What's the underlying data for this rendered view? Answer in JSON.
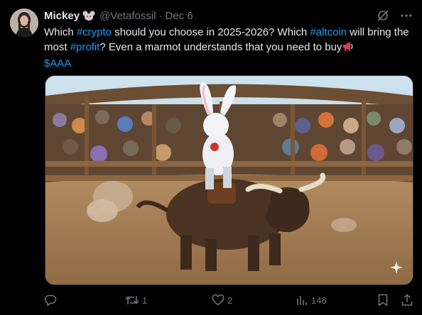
{
  "author": {
    "name": "Mickey",
    "emoji_icon": "mouse-face-icon",
    "handle": "@Vetafossil",
    "separator": "·",
    "date": "Dec 6"
  },
  "tweet": {
    "segments": [
      {
        "text": "Which ",
        "type": "plain"
      },
      {
        "text": "#crypto",
        "type": "hashtag"
      },
      {
        "text": " should you choose in 2025-2026?  Which ",
        "type": "plain"
      },
      {
        "text": "#altcoin",
        "type": "hashtag"
      },
      {
        "text": " will bring the most ",
        "type": "plain"
      },
      {
        "text": "#profit",
        "type": "hashtag"
      },
      {
        "text": "?  Even a marmot understands that you need to buy",
        "type": "plain"
      },
      {
        "text": "$AAA",
        "type": "cashtag"
      }
    ],
    "emoji_after_buy": "loudspeaker-icon"
  },
  "media": {
    "description_icon": "sparkle-icon"
  },
  "actions": {
    "reply_count": "",
    "retweet_count": "1",
    "like_count": "2",
    "views_count": "146"
  },
  "colors": {
    "background": "#000000",
    "text": "#e7e9ea",
    "muted": "#71767b",
    "accent": "#1d9bf0"
  }
}
